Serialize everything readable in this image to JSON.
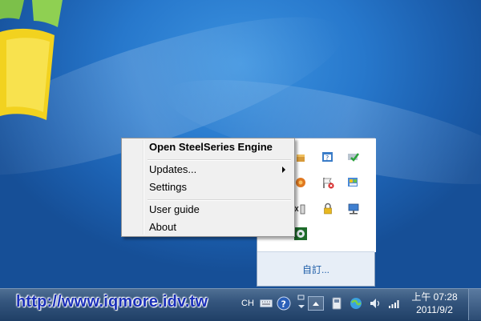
{
  "context_menu": {
    "items": [
      {
        "label": "Open SteelSeries Engine",
        "bold": true
      },
      {
        "label": "Updates...",
        "submenu": true
      },
      {
        "label": "Settings"
      },
      {
        "label": "User guide"
      },
      {
        "label": "About"
      }
    ]
  },
  "tray_flyout": {
    "customize_label": "自訂...",
    "icons": [
      "package-icon",
      "help-window-icon",
      "check-monitor-icon",
      "orange-gear-icon",
      "flag-x-icon",
      "colorful-window-icon",
      "battery-x-icon",
      "lock-icon",
      "network-computer-icon",
      "steelseries-icon"
    ]
  },
  "taskbar": {
    "watermark": "http://www.iqmore.idv.tw",
    "language": "CH",
    "time": "上午 07:28",
    "date": "2011/9/2",
    "colors": {
      "taskbar": "#34557d",
      "menu_bg": "#f0f0f0",
      "watermark": "#1a2fb8"
    }
  }
}
